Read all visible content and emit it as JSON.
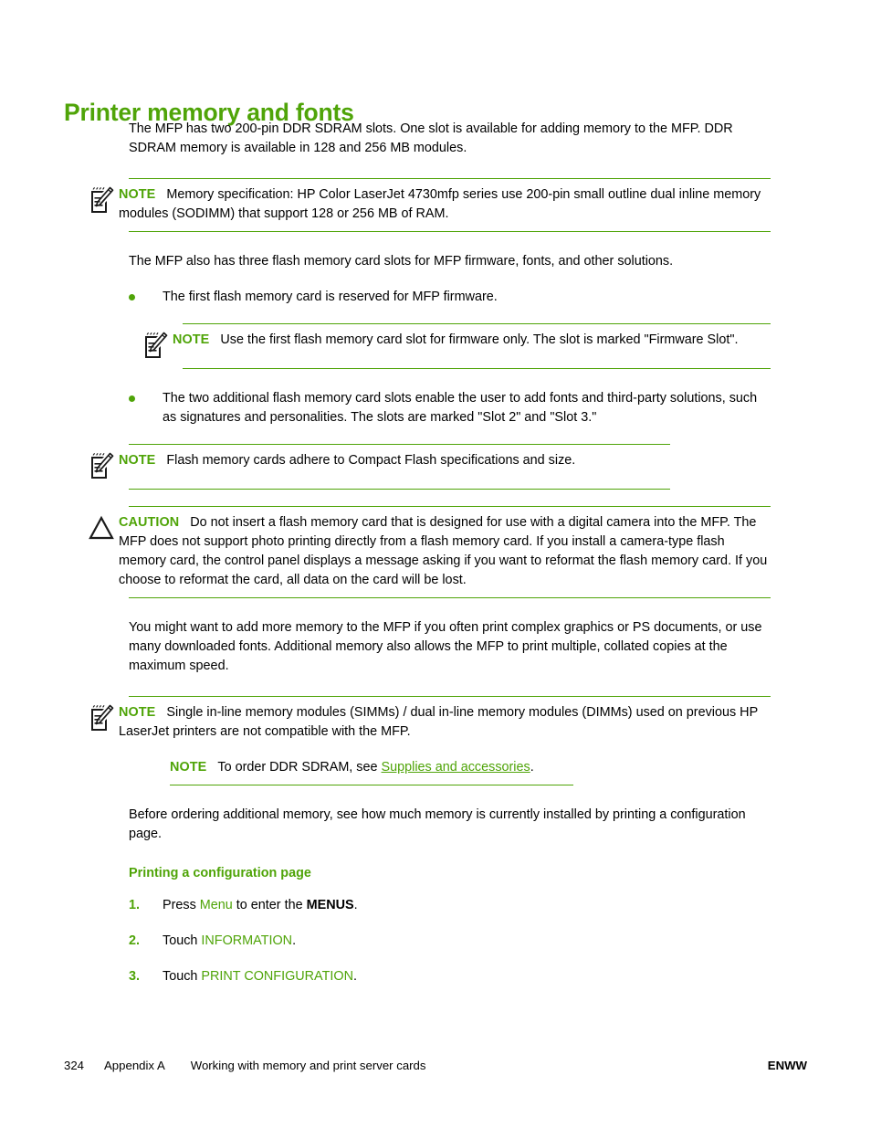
{
  "heading": "Printer memory and fonts",
  "intro": "The MFP has two 200-pin DDR SDRAM slots. One slot is available for adding memory to the MFP. DDR SDRAM memory is available in 128 and 256 MB modules.",
  "note1": {
    "label": "NOTE",
    "icon": "note-pencil-icon",
    "text": "Memory specification: HP Color LaserJet 4730mfp series use 200-pin small outline dual inline memory modules (SODIMM) that support 128 or 256 MB of RAM."
  },
  "para2": "The MFP also has three flash memory card slots for MFP firmware, fonts, and other solutions.",
  "bullet1": "The first flash memory card is reserved for MFP firmware.",
  "note2": {
    "label": "NOTE",
    "icon": "note-pencil-icon",
    "text": "Use the first flash memory card slot for firmware only. The slot is marked \"Firmware Slot\"."
  },
  "bullet2": "The two additional flash memory card slots enable the user to add fonts and third-party solutions, such as signatures and personalities. The slots are marked \"Slot 2\" and \"Slot 3.\"",
  "note3": {
    "label": "NOTE",
    "icon": "note-pencil-icon",
    "text": "Flash memory cards adhere to Compact Flash specifications and size."
  },
  "caution": {
    "label": "CAUTION",
    "icon": "warning-triangle-icon",
    "text": "Do not insert a flash memory card that is designed for use with a digital camera into the MFP. The MFP does not support photo printing directly from a flash memory card. If you install a camera-type flash memory card, the control panel displays a message asking if you want to reformat the flash memory card. If you choose to reformat the card, all data on the card will be lost."
  },
  "para3": "You might want to add more memory to the MFP if you often print complex graphics or PS documents, or use many downloaded fonts. Additional memory also allows the MFP to print multiple, collated copies at the maximum speed.",
  "note4": {
    "label": "NOTE",
    "icon": "note-pencil-icon",
    "text": "Single in-line memory modules (SIMMs) / dual in-line memory modules (DIMMs) used on previous HP LaserJet printers are not compatible with the MFP."
  },
  "note5": {
    "label": "NOTE",
    "text_before": "To order DDR SDRAM, see ",
    "link": "Supplies and accessories",
    "text_after": "."
  },
  "para4": "Before ordering additional memory, see how much memory is currently installed by printing a configuration page.",
  "sub_heading": "Printing a configuration page",
  "steps": [
    {
      "number": "1.",
      "before": "Press ",
      "ui_term": "Menu",
      "middle": " to enter the ",
      "bold_term": "MENUS",
      "after": "."
    },
    {
      "number": "2.",
      "before": "Touch ",
      "ui_term": "INFORMATION",
      "after": "."
    },
    {
      "number": "3.",
      "before": "Touch ",
      "ui_term": "PRINT CONFIGURATION",
      "after": "."
    }
  ],
  "footer": {
    "page_number": "324",
    "appendix": "Appendix A",
    "title": "Working with memory and print server cards",
    "right": "ENWW"
  },
  "colors": {
    "accent_green": "#4fa408",
    "text_black": "#000000"
  }
}
